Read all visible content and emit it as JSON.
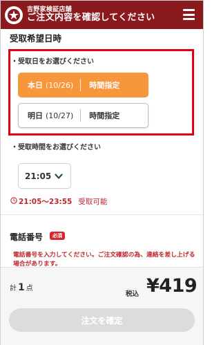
{
  "header": {
    "store_name": "吉野家検証店舗",
    "title": "ご注文内容を確認してください",
    "menu_icon": "hamburger-menu-icon",
    "logo_icon": "yoshinoya-logo-icon",
    "color": "#8b1a1f"
  },
  "pickup": {
    "heading": "受取希望日時",
    "date_prompt": "・受取日をお選びください",
    "options": [
      {
        "day": "本日",
        "date": "(10/26)",
        "time_label": "時間指定",
        "selected": true
      },
      {
        "day": "明日",
        "date": "(10/27)",
        "time_label": "時間指定",
        "selected": false
      }
    ],
    "time_prompt": "・受取時間をお選びください",
    "time_value": "21:05",
    "range": "21:05〜23:55",
    "availability": "受取可能",
    "selected_color": "#f7963b",
    "highlight_color": "#e3000f"
  },
  "phone": {
    "heading": "電話番号",
    "required": "必須",
    "note": "電話番号を入力してください。ご注文確認の為、連絡を差し上げる場合があります。"
  },
  "footer": {
    "count_prefix": "計",
    "count": "1",
    "count_suffix": "点",
    "tax_label": "税込",
    "total": "¥419",
    "confirm_label": "注文を確定"
  }
}
